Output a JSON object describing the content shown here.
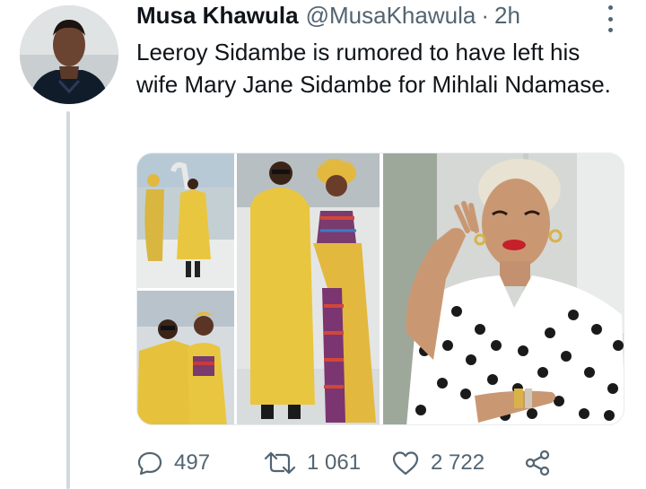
{
  "tweet": {
    "author_name": "Musa Khawula",
    "handle": "@MusaKhawula",
    "separator": "·",
    "time": "2h",
    "text": "Leeroy Sidambe is rumored to have left his wife Mary Jane Sidambe for Mihlali Ndamase.",
    "media": {
      "photos": [
        "couple-in-yellow-outfits-full-length",
        "couple-in-yellow-outfits-close-up",
        "couple-in-yellow-outfits-posing",
        "woman-polka-dot-blouse-portrait"
      ]
    }
  },
  "actions": {
    "replies": "497",
    "retweets": "1 061",
    "likes": "2 722"
  },
  "colors": {
    "secondary_text": "#536471",
    "thread_line": "#cfd9de",
    "outfit_yellow": "#e9c63f"
  }
}
